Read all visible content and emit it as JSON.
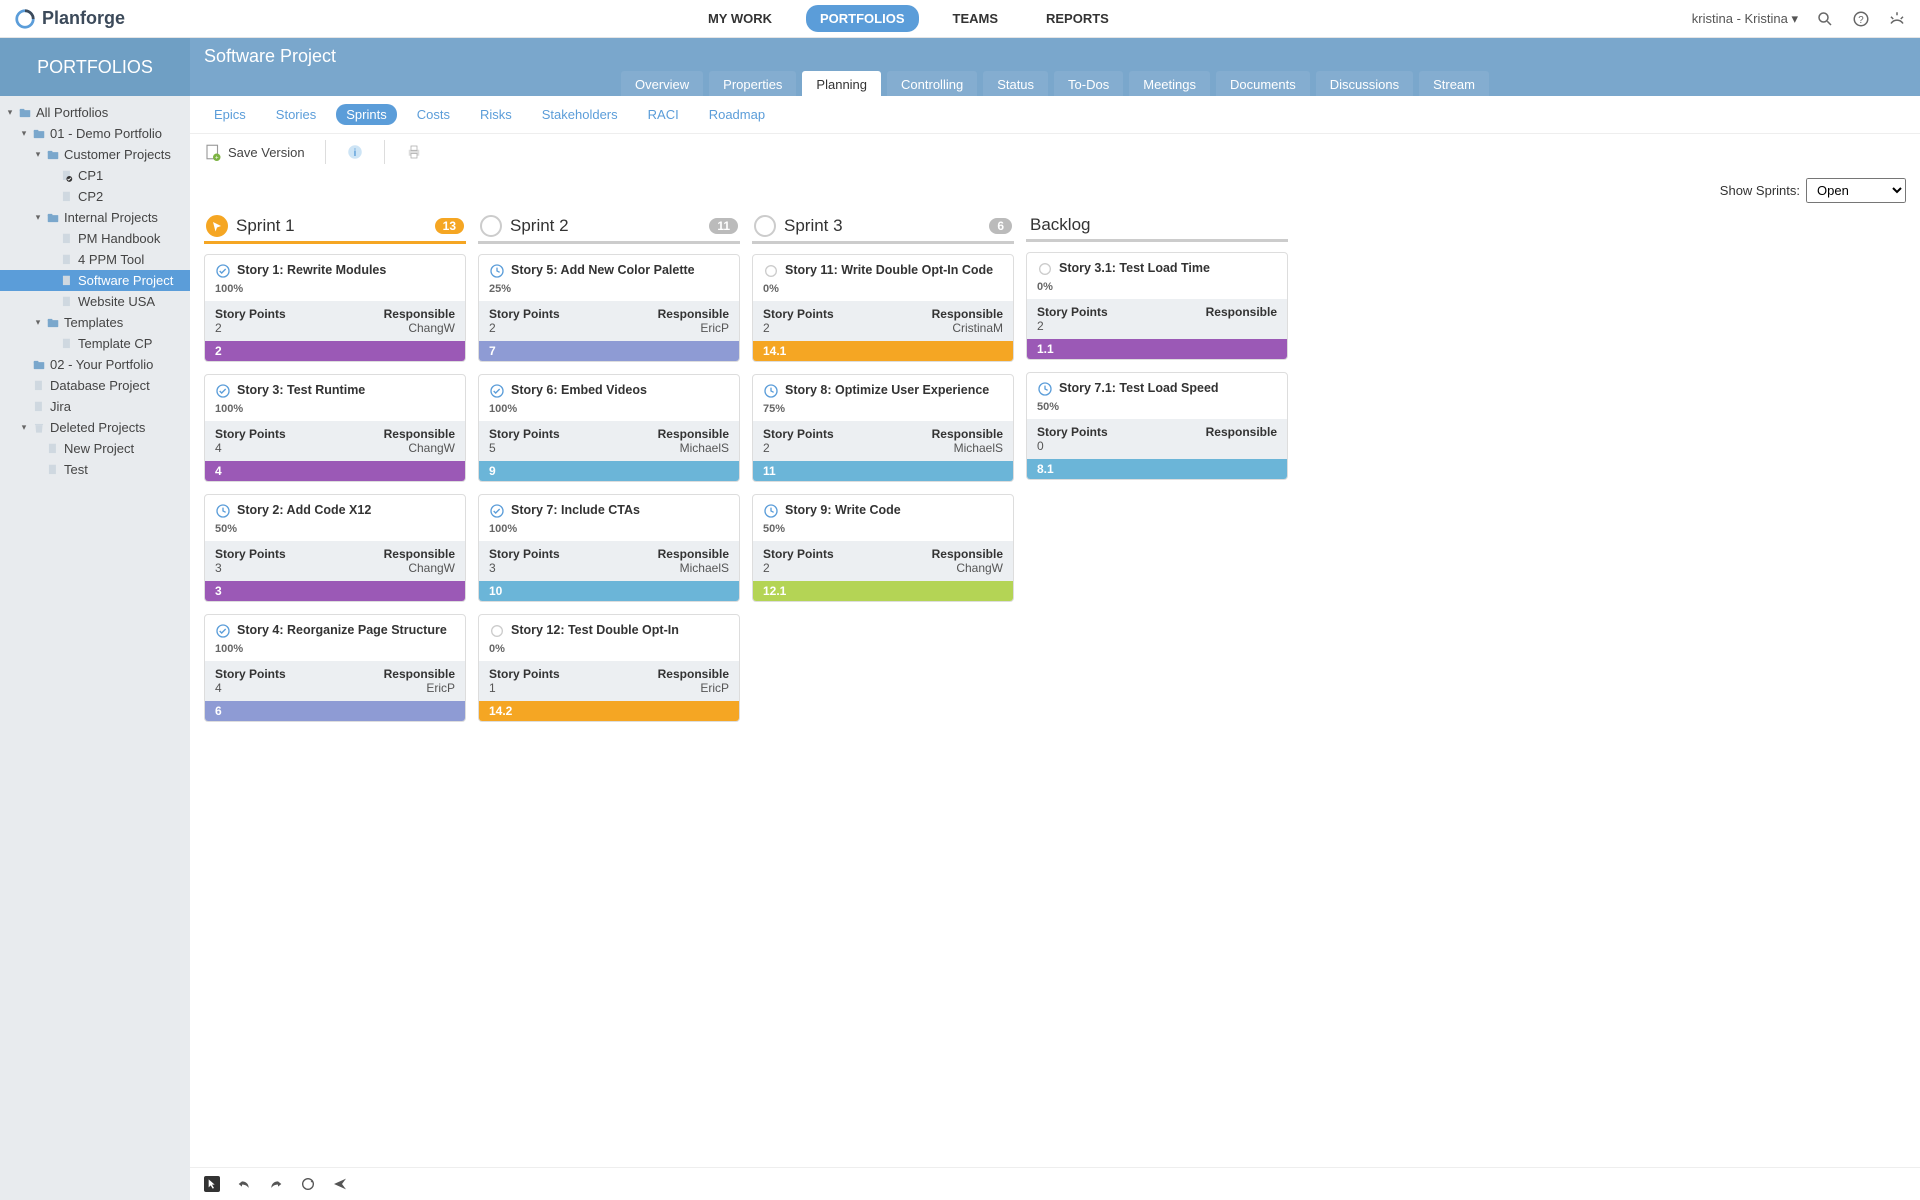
{
  "brand": "Planforge",
  "topnav": {
    "items": [
      "MY WORK",
      "PORTFOLIOS",
      "TEAMS",
      "REPORTS"
    ],
    "active": 1
  },
  "user_label": "kristina - Kristina",
  "subheader": {
    "left": "PORTFOLIOS",
    "title": "Software Project"
  },
  "main_tabs": {
    "items": [
      "Overview",
      "Properties",
      "Planning",
      "Controlling",
      "Status",
      "To-Dos",
      "Meetings",
      "Documents",
      "Discussions",
      "Stream"
    ],
    "active": 2
  },
  "subtabs": {
    "items": [
      "Epics",
      "Stories",
      "Sprints",
      "Costs",
      "Risks",
      "Stakeholders",
      "RACI",
      "Roadmap"
    ],
    "active": 2
  },
  "toolbar": {
    "save": "Save Version"
  },
  "filter": {
    "label": "Show Sprints:",
    "value": "Open"
  },
  "tree": [
    {
      "label": "All Portfolios",
      "indent": 0,
      "caret": true,
      "icon": "folder"
    },
    {
      "label": "01 - Demo Portfolio",
      "indent": 1,
      "caret": true,
      "icon": "folder"
    },
    {
      "label": "Customer Projects",
      "indent": 2,
      "caret": true,
      "icon": "folder"
    },
    {
      "label": "CP1",
      "indent": 3,
      "caret": false,
      "icon": "doc-check"
    },
    {
      "label": "CP2",
      "indent": 3,
      "caret": false,
      "icon": "doc"
    },
    {
      "label": "Internal Projects",
      "indent": 2,
      "caret": true,
      "icon": "folder"
    },
    {
      "label": "PM Handbook",
      "indent": 3,
      "caret": false,
      "icon": "doc"
    },
    {
      "label": "4 PPM Tool",
      "indent": 3,
      "caret": false,
      "icon": "doc"
    },
    {
      "label": "Software Project",
      "indent": 3,
      "caret": false,
      "icon": "doc",
      "selected": true
    },
    {
      "label": "Website USA",
      "indent": 3,
      "caret": false,
      "icon": "doc"
    },
    {
      "label": "Templates",
      "indent": 2,
      "caret": true,
      "icon": "folder"
    },
    {
      "label": "Template CP",
      "indent": 3,
      "caret": false,
      "icon": "doc"
    },
    {
      "label": "02 - Your Portfolio",
      "indent": 1,
      "caret": false,
      "icon": "folder"
    },
    {
      "label": "Database Project",
      "indent": 1,
      "caret": false,
      "icon": "doc"
    },
    {
      "label": "Jira",
      "indent": 1,
      "caret": false,
      "icon": "doc"
    },
    {
      "label": "Deleted Projects",
      "indent": 1,
      "caret": true,
      "icon": "trash"
    },
    {
      "label": "New Project",
      "indent": 2,
      "caret": false,
      "icon": "doc"
    },
    {
      "label": "Test",
      "indent": 2,
      "caret": false,
      "icon": "doc"
    }
  ],
  "columns": [
    {
      "title": "Sprint 1",
      "badge": "13",
      "active": true,
      "cards": [
        {
          "title": "Story 1: Rewrite Modules",
          "pct": "100%",
          "sp": "2",
          "resp": "ChangW",
          "bar": "2",
          "color": "#9b59b6",
          "status": "done"
        },
        {
          "title": "Story 3: Test Runtime",
          "pct": "100%",
          "sp": "4",
          "resp": "ChangW",
          "bar": "4",
          "color": "#9b59b6",
          "status": "done"
        },
        {
          "title": "Story 2: Add Code X12",
          "pct": "50%",
          "sp": "3",
          "resp": "ChangW",
          "bar": "3",
          "color": "#9b59b6",
          "status": "prog"
        },
        {
          "title": "Story 4: Reorganize Page Structure",
          "pct": "100%",
          "sp": "4",
          "resp": "EricP",
          "bar": "6",
          "color": "#8e9bd4",
          "status": "done"
        }
      ]
    },
    {
      "title": "Sprint 2",
      "badge": "11",
      "active": false,
      "cards": [
        {
          "title": "Story 5: Add New Color Palette",
          "pct": "25%",
          "sp": "2",
          "resp": "EricP",
          "bar": "7",
          "color": "#8e9bd4",
          "status": "prog"
        },
        {
          "title": "Story 6: Embed Videos",
          "pct": "100%",
          "sp": "5",
          "resp": "MichaelS",
          "bar": "9",
          "color": "#6bb5d8",
          "status": "done"
        },
        {
          "title": "Story 7: Include CTAs",
          "pct": "100%",
          "sp": "3",
          "resp": "MichaelS",
          "bar": "10",
          "color": "#6bb5d8",
          "status": "done"
        },
        {
          "title": "Story 12: Test Double Opt-In",
          "pct": "0%",
          "sp": "1",
          "resp": "EricP",
          "bar": "14.2",
          "color": "#f5a623",
          "status": "todo"
        }
      ]
    },
    {
      "title": "Sprint 3",
      "badge": "6",
      "active": false,
      "cards": [
        {
          "title": "Story 11: Write Double Opt-In Code",
          "pct": "0%",
          "sp": "2",
          "resp": "CristinaM",
          "bar": "14.1",
          "color": "#f5a623",
          "status": "todo"
        },
        {
          "title": "Story 8: Optimize User Experience",
          "pct": "75%",
          "sp": "2",
          "resp": "MichaelS",
          "bar": "11",
          "color": "#6bb5d8",
          "status": "prog"
        },
        {
          "title": "Story 9: Write Code",
          "pct": "50%",
          "sp": "2",
          "resp": "ChangW",
          "bar": "12.1",
          "color": "#b4d455",
          "status": "prog"
        }
      ]
    },
    {
      "title": "Backlog",
      "badge": "",
      "active": false,
      "backlog": true,
      "cards": [
        {
          "title": "Story 3.1: Test Load Time",
          "pct": "0%",
          "sp": "2",
          "resp": "",
          "bar": "1.1",
          "color": "#9b59b6",
          "status": "todo"
        },
        {
          "title": "Story 7.1: Test Load Speed",
          "pct": "50%",
          "sp": "0",
          "resp": "",
          "bar": "8.1",
          "color": "#6bb5d8",
          "status": "prog"
        }
      ]
    }
  ],
  "labels": {
    "sp": "Story Points",
    "resp": "Responsible"
  }
}
